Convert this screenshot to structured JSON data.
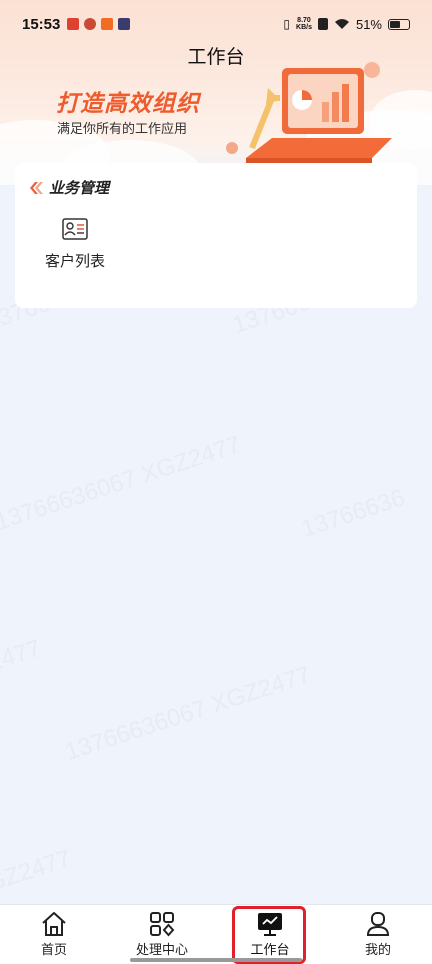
{
  "status_bar": {
    "time": "15:53",
    "net_speed_value": "8.70",
    "net_speed_unit": "KB/s",
    "battery": "51%"
  },
  "header": {
    "title": "工作台",
    "slogan": "打造高效组织",
    "subtitle": "满足你所有的工作应用"
  },
  "business": {
    "title": "业务管理",
    "items": [
      {
        "label": "客户列表",
        "icon": "contact-card-icon"
      }
    ]
  },
  "watermark_text": "13766636067 XGZ2477",
  "bottom_nav": {
    "items": [
      {
        "label": "首页",
        "icon": "home-icon"
      },
      {
        "label": "处理中心",
        "icon": "grid-icon"
      },
      {
        "label": "工作台",
        "icon": "monitor-icon",
        "active": true
      },
      {
        "label": "我的",
        "icon": "person-icon"
      }
    ]
  },
  "colors": {
    "accent": "#ee5b2c",
    "highlight": "#e0202a",
    "background": "#eff3fb"
  }
}
